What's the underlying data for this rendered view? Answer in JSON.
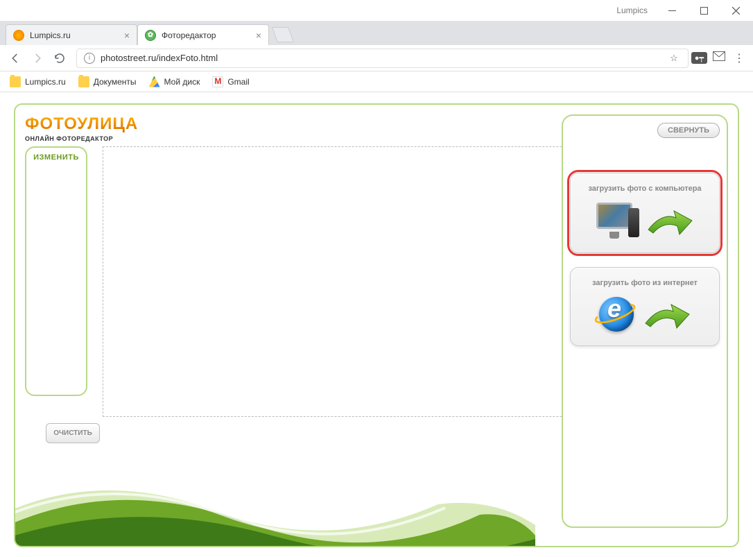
{
  "window": {
    "title": "Lumpics"
  },
  "tabs": [
    {
      "label": "Lumpics.ru",
      "active": false
    },
    {
      "label": "Фоторедактор",
      "active": true
    }
  ],
  "address": {
    "url": "photostreet.ru/indexFoto.html"
  },
  "bookmarks": [
    {
      "label": "Lumpics.ru",
      "icon": "folder"
    },
    {
      "label": "Документы",
      "icon": "folder"
    },
    {
      "label": "Мой диск",
      "icon": "drive"
    },
    {
      "label": "Gmail",
      "icon": "gmail"
    }
  ],
  "app": {
    "logo_main": "ФОТОУЛИЦА",
    "logo_sub": "ОНЛАЙН  ФОТОРЕДАКТОР",
    "left": {
      "edit_label": "ИЗМЕНИТЬ",
      "clear_label": "ОЧИСТИТЬ"
    },
    "right": {
      "collapse_label": "СВЕРНУТЬ",
      "upload_pc": "загрузить фото с компьютера",
      "upload_net": "загрузить фото из интернет"
    }
  }
}
